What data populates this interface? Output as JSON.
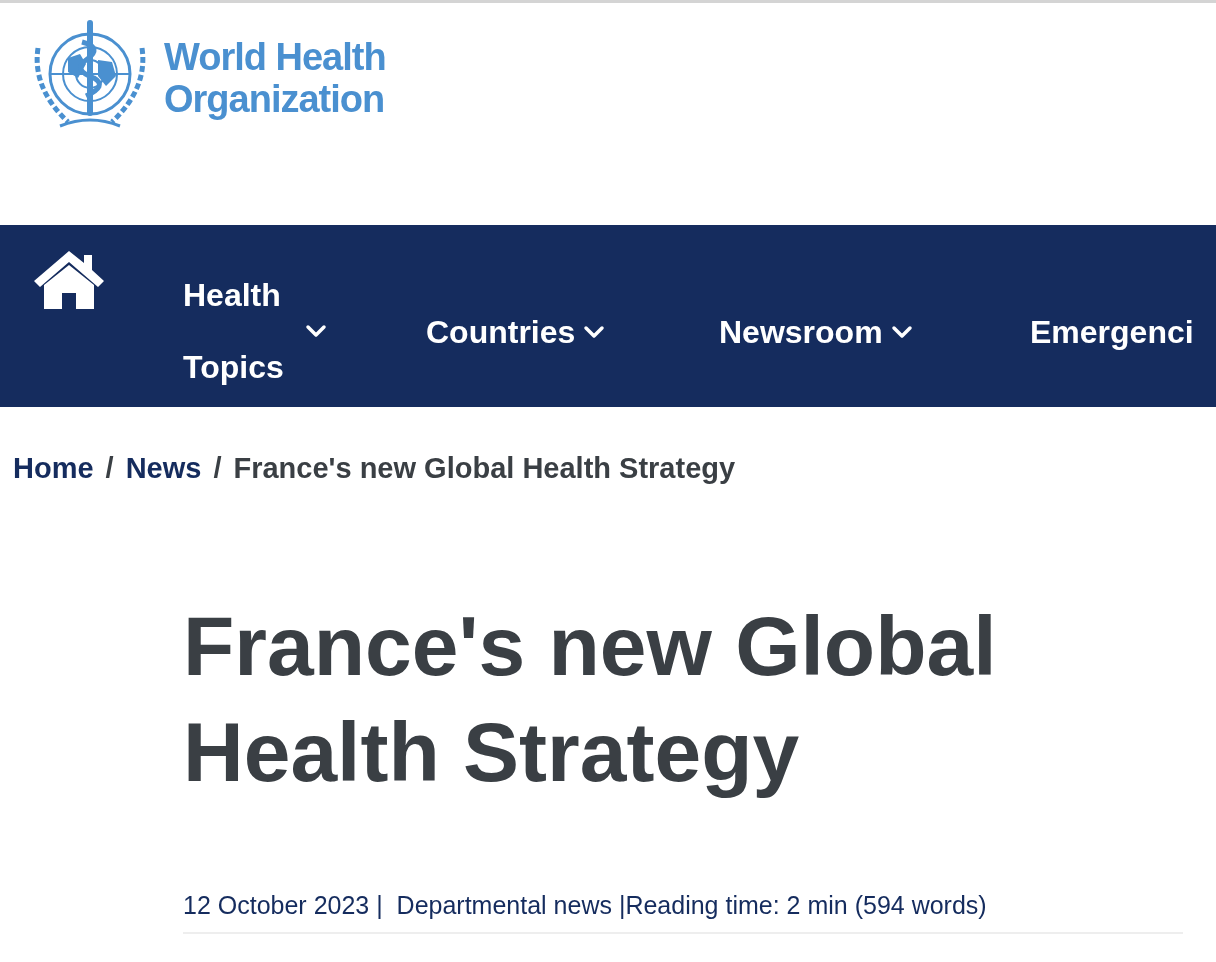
{
  "logo": {
    "line_1": "World Health",
    "line_2": "Organization"
  },
  "nav": {
    "items": [
      {
        "label": "Health Topics",
        "kind": "wrapped",
        "dropdown": true
      },
      {
        "label": "Countries",
        "kind": "inline",
        "dropdown": true
      },
      {
        "label": "Newsroom",
        "kind": "inline",
        "dropdown": true
      },
      {
        "label": "Emergenci",
        "kind": "inline",
        "dropdown": false
      }
    ]
  },
  "breadcrumb": [
    {
      "label": "Home",
      "kind": "link"
    },
    {
      "label": "/",
      "kind": "separator"
    },
    {
      "label": "News",
      "kind": "link"
    },
    {
      "label": "/",
      "kind": "separator"
    },
    {
      "label": "France's new Global Health Strategy",
      "kind": "current"
    }
  ],
  "article": {
    "title": "France's new Global Health Strategy",
    "meta": "12 October 2023 |  Departmental news |Reading time: 2 min (594 words)"
  }
}
